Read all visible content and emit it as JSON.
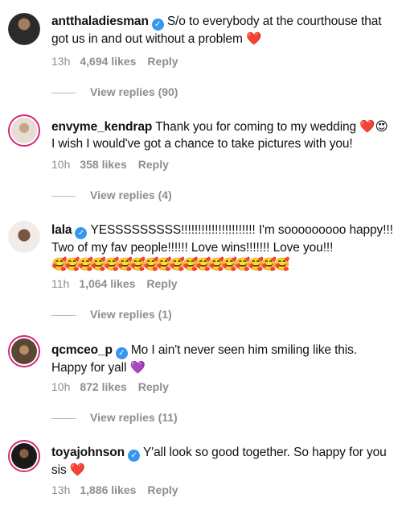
{
  "comments": [
    {
      "username": "antthaladiesman",
      "verified": true,
      "text": "S/o to everybody at the courthouse that got us in and out without a problem",
      "emoji": "❤️",
      "time": "13h",
      "likes": "4,694 likes",
      "reply": "Reply",
      "view_replies": "View replies (90)"
    },
    {
      "username": "envyme_kendrap",
      "verified": false,
      "text": "Thank you for coming to my wedding",
      "emoji": "❤️😍",
      "text2": "I wish I would've got a chance to take pictures with you!",
      "time": "10h",
      "likes": "358 likes",
      "reply": "Reply",
      "view_replies": "View replies (4)"
    },
    {
      "username": "lala",
      "verified": true,
      "text": "YESSSSSSSSS!!!!!!!!!!!!!!!!!!!!!! I'm sooooooooo happy!!! Two of my fav people!!!!!! Love wins!!!!!!! Love you!!!",
      "emoji": "🥰🥰🥰🥰🥰🥰🥰🥰🥰🥰🥰🥰🥰🥰🥰🥰🥰🥰",
      "time": "11h",
      "likes": "1,064 likes",
      "reply": "Reply",
      "view_replies": "View replies (1)"
    },
    {
      "username": "qcmceo_p",
      "verified": true,
      "text": "Mo I ain't never seen him smiling like this. Happy for yall",
      "emoji": "💜",
      "time": "10h",
      "likes": "872 likes",
      "reply": "Reply",
      "view_replies": "View replies (11)"
    },
    {
      "username": "toyajohnson",
      "verified": true,
      "text": "Y'all look so good together. So happy for you sis",
      "emoji": "❤️",
      "time": "13h",
      "likes": "1,886 likes",
      "reply": "Reply"
    }
  ],
  "colors": {
    "verified_badge": "#3797f0",
    "story_ring": "#d62976",
    "meta_gray": "#8e8e8e"
  }
}
